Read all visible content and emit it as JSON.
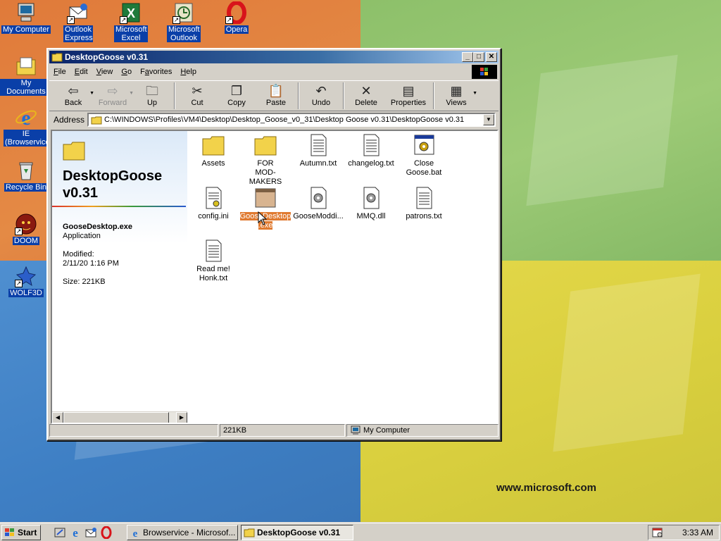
{
  "desktop": {
    "brand_text": "www.microsoft.com",
    "icons": [
      {
        "label": "My Computer",
        "icon": "my-computer-icon"
      },
      {
        "label": "Outlook Express",
        "icon": "outlook-express-icon"
      },
      {
        "label": "Microsoft Excel",
        "icon": "excel-icon"
      },
      {
        "label": "Microsoft Outlook",
        "icon": "outlook-icon"
      },
      {
        "label": "Opera",
        "icon": "opera-icon"
      },
      {
        "label": "My Documents",
        "icon": "my-documents-icon"
      },
      {
        "label": "IE (Browservice)",
        "icon": "ie-icon"
      },
      {
        "label": "Recycle Bin",
        "icon": "recycle-bin-icon"
      },
      {
        "label": "DOOM",
        "icon": "doom-icon"
      },
      {
        "label": "WOLF3D",
        "icon": "wolf3d-icon"
      }
    ]
  },
  "window": {
    "title": "DesktopGoose v0.31",
    "controls": {
      "minimize": "_",
      "maximize": "□",
      "close": "✕"
    },
    "menu": [
      {
        "label": "File",
        "key": "F",
        "rest": "ile"
      },
      {
        "label": "Edit",
        "key": "E",
        "rest": "dit"
      },
      {
        "label": "View",
        "key": "V",
        "rest": "iew"
      },
      {
        "label": "Go",
        "key": "G",
        "rest": "o"
      },
      {
        "label": "Favorites",
        "key": "F",
        "pre": "",
        "rest": "avorites",
        "underline_index": 1
      },
      {
        "label": "Help",
        "key": "H",
        "rest": "elp"
      }
    ],
    "toolbar": {
      "back": "Back",
      "forward": "Forward",
      "up": "Up",
      "cut": "Cut",
      "copy": "Copy",
      "paste": "Paste",
      "undo": "Undo",
      "delete": "Delete",
      "properties": "Properties",
      "views": "Views"
    },
    "address": {
      "label": "Address",
      "value": "C:\\WINDOWS\\Profiles\\VM4\\Desktop\\Desktop_Goose_v0_31\\Desktop Goose v0.31\\DesktopGoose v0.31"
    },
    "webview": {
      "folder_title_line1": "DesktopGoose",
      "folder_title_line2": "v0.31",
      "selected_name": "GooseDesktop.exe",
      "selected_type": "Application",
      "modified_label": "Modified:",
      "modified_value": "2/11/20 1:16 PM",
      "size_text": "Size: 221KB"
    },
    "files": [
      {
        "line1": "Assets",
        "line2": "",
        "icon": "folder-icon"
      },
      {
        "line1": "FOR",
        "line2": "MOD-MAKERS",
        "icon": "folder-icon"
      },
      {
        "line1": "Autumn.txt",
        "line2": "",
        "icon": "text-file-icon"
      },
      {
        "line1": "changelog.txt",
        "line2": "",
        "icon": "text-file-icon"
      },
      {
        "line1": "Close",
        "line2": "Goose.bat",
        "icon": "batch-file-icon"
      },
      {
        "line1": "config.ini",
        "line2": "",
        "icon": "ini-file-icon"
      },
      {
        "line1": "GooseDesktop",
        "line2": ".exe",
        "icon": "application-icon",
        "selected": true
      },
      {
        "line1": "GooseModdi...",
        "line2": "",
        "icon": "dll-file-icon"
      },
      {
        "line1": "MMQ.dll",
        "line2": "",
        "icon": "dll-file-icon"
      },
      {
        "line1": "patrons.txt",
        "line2": "",
        "icon": "text-file-icon"
      },
      {
        "line1": "Read me!",
        "line2": "Honk.txt",
        "icon": "text-file-icon"
      }
    ],
    "status": {
      "left": "",
      "size": "221KB",
      "zone": "My Computer"
    }
  },
  "taskbar": {
    "start_label": "Start",
    "tasks": [
      {
        "label": "Browservice - Microsof..."
      },
      {
        "label": "DesktopGoose v0.31",
        "active": true
      }
    ],
    "clock": "3:33 AM"
  }
}
